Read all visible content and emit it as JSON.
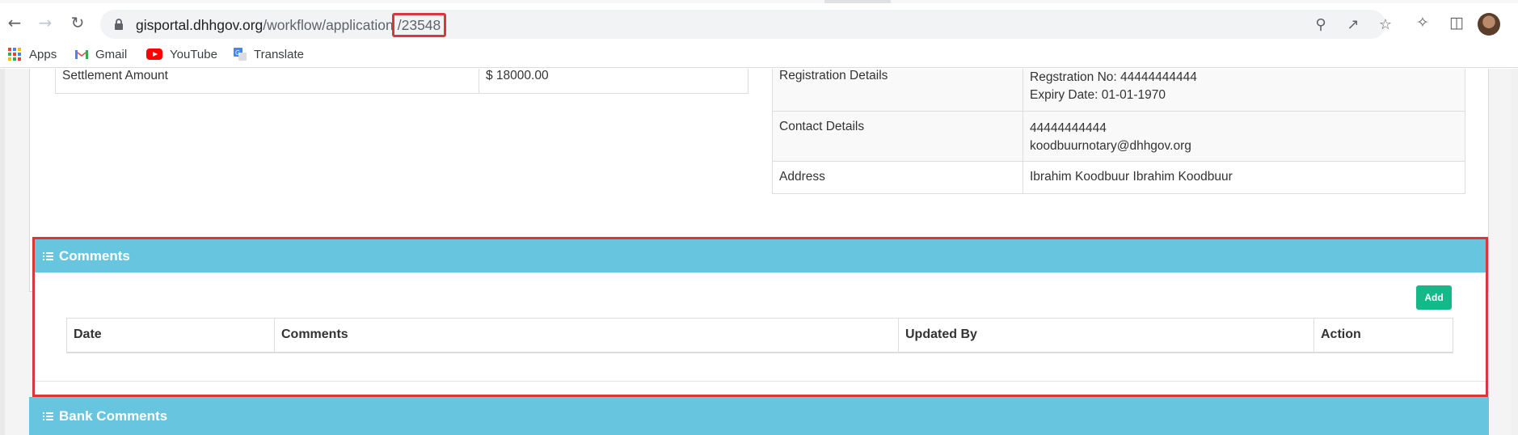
{
  "browser": {
    "url_host": "gisportal.dhhgov.org",
    "url_path": "/workflow/application",
    "url_id": "/23548",
    "bookmarks": [
      "Apps",
      "Gmail",
      "YouTube",
      "Translate"
    ]
  },
  "settlement": {
    "label": "Settlement Amount",
    "value": "$ 18000.00"
  },
  "notary": {
    "registration_label": "Registration Details",
    "registration_no": "Regstration No: 44444444444",
    "expiry": "Expiry Date: 01-01-1970",
    "contact_label": "Contact Details",
    "phone": "44444444444",
    "email": "koodbuurnotary@dhhgov.org",
    "address_label": "Address",
    "address": "Ibrahim Koodbuur Ibrahim Koodbuur"
  },
  "comments": {
    "title": "Comments",
    "add_label": "Add",
    "columns": [
      "Date",
      "Comments",
      "Updated By",
      "Action"
    ]
  },
  "bank_comments": {
    "title": "Bank Comments"
  },
  "colors": {
    "header": "#67c5e0",
    "add_button": "#14b98a",
    "highlight": "#d9363e"
  }
}
